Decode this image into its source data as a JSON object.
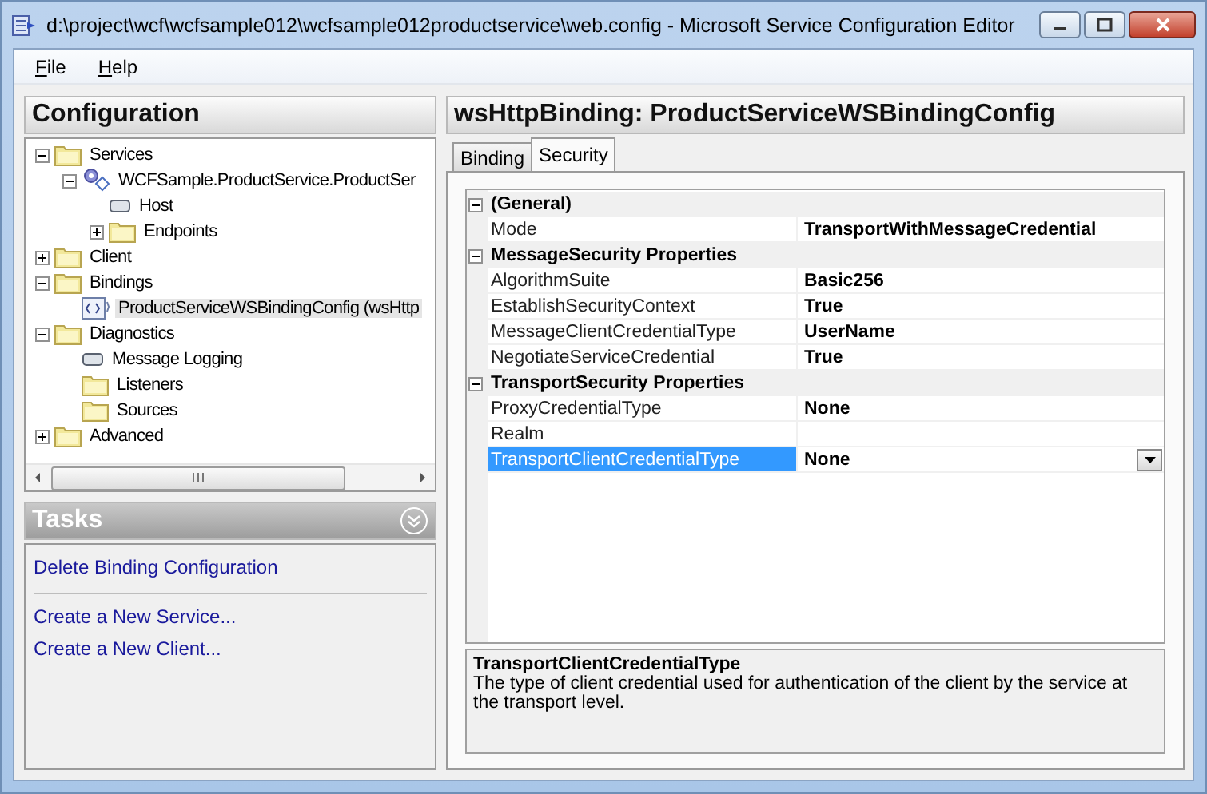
{
  "window": {
    "title": "d:\\project\\wcf\\wcfsample012\\wcfsample012productservice\\web.config - Microsoft Service Configuration Editor"
  },
  "menu": [
    {
      "label": "File"
    },
    {
      "label": "Help"
    }
  ],
  "configuration": {
    "title": "Configuration",
    "tree": [
      {
        "label": "Services",
        "kind": "folder",
        "expanded": true,
        "children": [
          {
            "label": "WCFSample.ProductService.ProductSer",
            "kind": "service",
            "expanded": true,
            "children": [
              {
                "label": "Host",
                "kind": "node"
              },
              {
                "label": "Endpoints",
                "kind": "folder",
                "expanded": false
              }
            ]
          }
        ]
      },
      {
        "label": "Client",
        "kind": "folder",
        "expanded": false
      },
      {
        "label": "Bindings",
        "kind": "folder",
        "expanded": true,
        "children": [
          {
            "label": "ProductServiceWSBindingConfig (wsHttp",
            "kind": "binding",
            "selected": true
          }
        ]
      },
      {
        "label": "Diagnostics",
        "kind": "folder",
        "expanded": true,
        "children": [
          {
            "label": "Message Logging",
            "kind": "node"
          },
          {
            "label": "Listeners",
            "kind": "folder"
          },
          {
            "label": "Sources",
            "kind": "folder"
          }
        ]
      },
      {
        "label": "Advanced",
        "kind": "folder",
        "expanded": false
      }
    ]
  },
  "tasks": {
    "title": "Tasks",
    "links": [
      {
        "label": "Delete Binding Configuration"
      },
      {
        "label": "Create a New Service...",
        "kind": "separated"
      },
      {
        "label": "Create a New Client..."
      }
    ]
  },
  "editor": {
    "title": "wsHttpBinding: ProductServiceWSBindingConfig",
    "tabs": [
      {
        "label": "Binding",
        "selected": false
      },
      {
        "label": "Security",
        "selected": true
      }
    ],
    "properties": [
      {
        "kind": "category",
        "name": "(General)",
        "expanded": true
      },
      {
        "kind": "property",
        "name": "Mode",
        "value": "TransportWithMessageCredential",
        "selected": false
      },
      {
        "kind": "category",
        "name": "MessageSecurity Properties",
        "expanded": true
      },
      {
        "kind": "property",
        "name": "AlgorithmSuite",
        "value": "Basic256",
        "selected": false
      },
      {
        "kind": "property",
        "name": "EstablishSecurityContext",
        "value": "True",
        "selected": false
      },
      {
        "kind": "property",
        "name": "MessageClientCredentialType",
        "value": "UserName",
        "selected": false
      },
      {
        "kind": "property",
        "name": "NegotiateServiceCredential",
        "value": "True",
        "selected": false
      },
      {
        "kind": "category",
        "name": "TransportSecurity Properties",
        "expanded": true
      },
      {
        "kind": "property",
        "name": "ProxyCredentialType",
        "value": "None",
        "selected": false
      },
      {
        "kind": "property",
        "name": "Realm",
        "selected": false
      },
      {
        "kind": "property",
        "name": "TransportClientCredentialType",
        "value": "None",
        "selected": true
      }
    ],
    "description": {
      "title": "TransportClientCredentialType",
      "text": "The type of client credential used for authentication of the client by the service at the transport level."
    }
  }
}
